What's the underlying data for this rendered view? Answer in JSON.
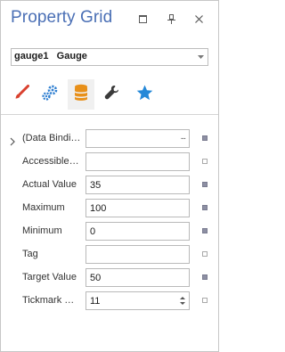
{
  "window": {
    "title": "Property Grid",
    "buttons": [
      {
        "icon": "restore-window-icon"
      },
      {
        "icon": "pin-icon"
      },
      {
        "icon": "close-icon"
      }
    ]
  },
  "object_selector": {
    "value": "gauge1   Gauge",
    "icon": "chevron-down-icon"
  },
  "tabs": [
    {
      "icon": "brush-icon",
      "color": "#d9402e",
      "active": false
    },
    {
      "icon": "gears-icon",
      "color": "#2f7fd1",
      "active": false
    },
    {
      "icon": "database-icon",
      "color": "#e8901a",
      "active": true
    },
    {
      "icon": "wrench-icon",
      "color": "#3a3a3a",
      "active": false
    },
    {
      "icon": "star-icon",
      "color": "#2488d8",
      "active": false
    }
  ],
  "properties": [
    {
      "label": "(Data Bindings)",
      "value": "",
      "expandable": true,
      "editor": "ellipsis",
      "modified": true
    },
    {
      "label": "Accessible Name",
      "value": "",
      "expandable": false,
      "editor": "text",
      "modified": false
    },
    {
      "label": "Actual Value",
      "value": "35",
      "expandable": false,
      "editor": "text",
      "modified": true
    },
    {
      "label": "Maximum",
      "value": "100",
      "expandable": false,
      "editor": "text",
      "modified": true
    },
    {
      "label": "Minimum",
      "value": "0",
      "expandable": false,
      "editor": "text",
      "modified": true
    },
    {
      "label": "Tag",
      "value": "",
      "expandable": false,
      "editor": "text",
      "modified": false
    },
    {
      "label": "Target Value",
      "value": "50",
      "expandable": false,
      "editor": "text",
      "modified": true
    },
    {
      "label": "Tickmark Count",
      "value": "11",
      "expandable": false,
      "editor": "spin",
      "modified": false
    }
  ],
  "ellipsis_label": "...",
  "colors": {
    "title": "#4a6fb5",
    "border": "#c7c7c7",
    "marker_modified": "#8d8fa3"
  }
}
